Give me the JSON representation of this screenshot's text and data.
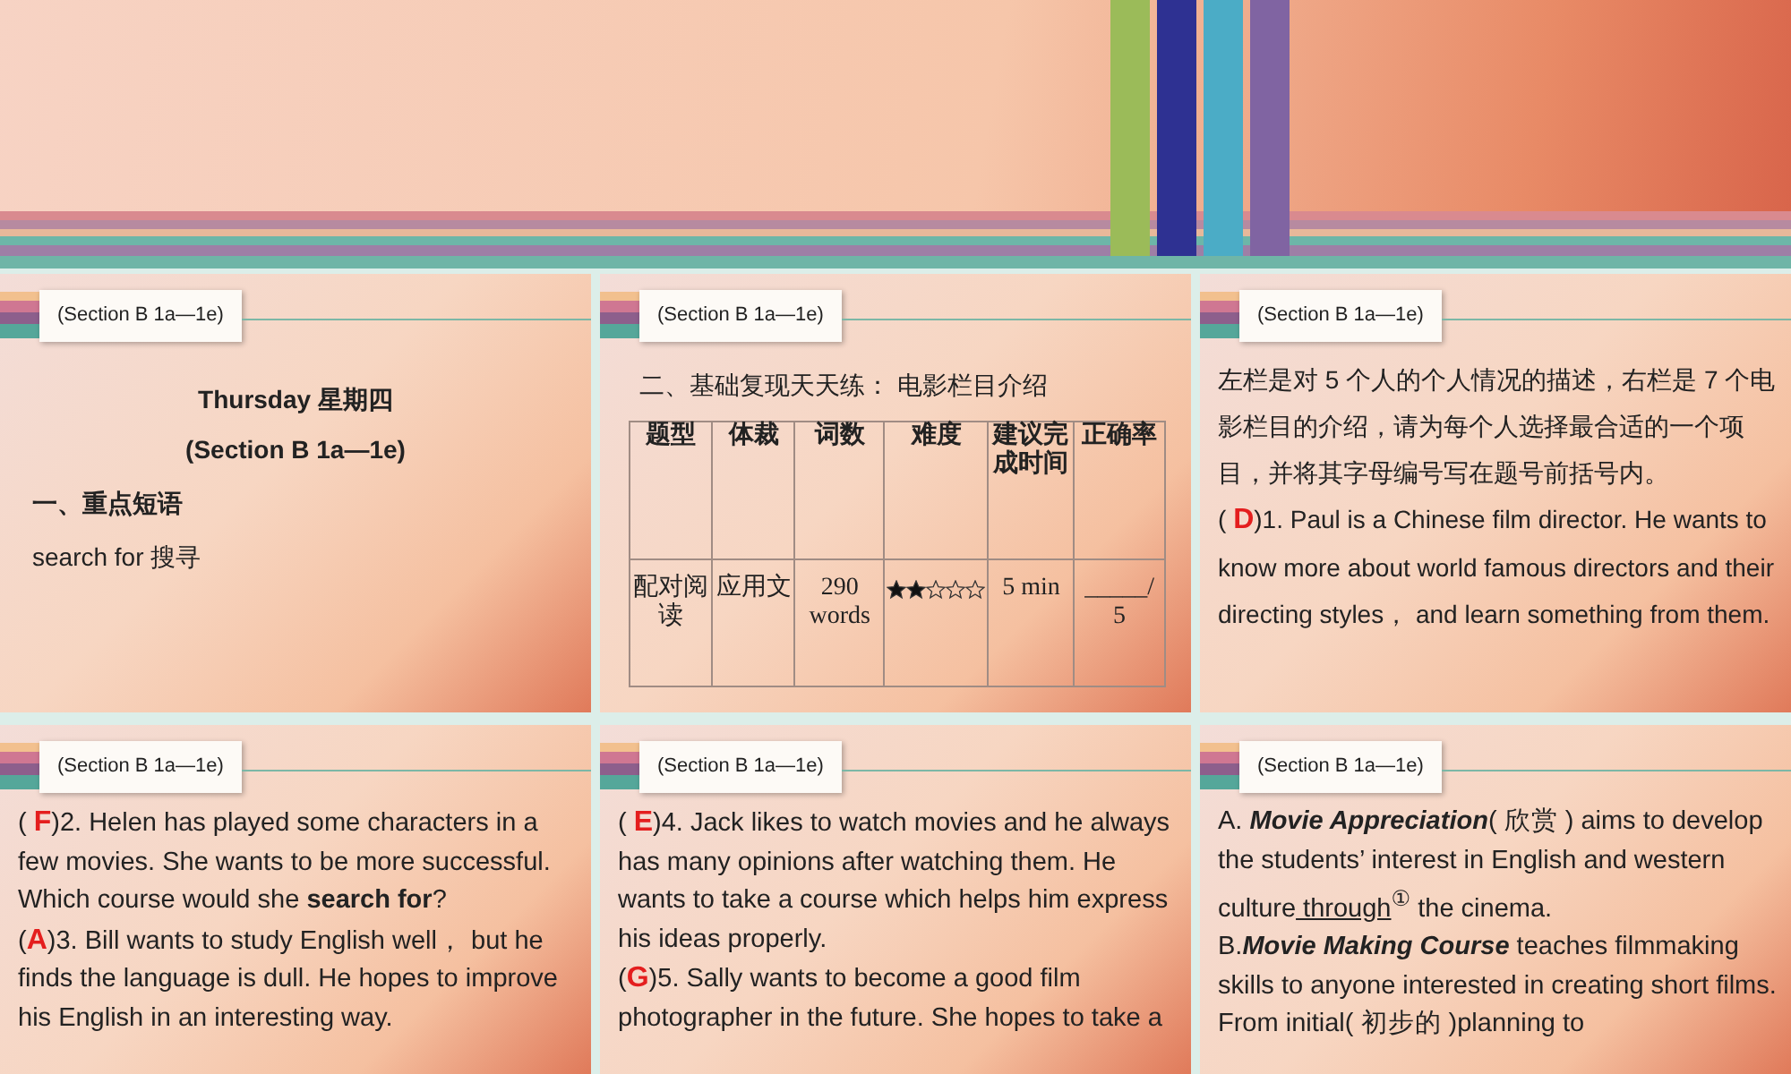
{
  "slides": [
    {
      "kind": "title",
      "header": "(Section B 1a—1e)",
      "title": "Thursday   星期四",
      "subtitle": "(Section B 1a—1e)",
      "heading": "一、重点短语",
      "lines": [
        "search for  搜寻"
      ]
    },
    {
      "kind": "table",
      "header": "(Section B 1a—1e)",
      "heading": "二、基础复现天天练：  电影栏目介绍",
      "columns": [
        "题型",
        "体裁",
        "词数",
        "难度",
        "建议完成时间",
        "正确率"
      ],
      "row": [
        {
          "kind": "text",
          "text": "配对阅读"
        },
        {
          "kind": "text",
          "text": "应用文"
        },
        {
          "kind": "text",
          "text": "290 words"
        },
        {
          "kind": "stars",
          "stars": 2
        },
        {
          "kind": "text",
          "text": "5 min"
        },
        {
          "kind": "text",
          "text": "_____/ 5"
        }
      ]
    },
    {
      "kind": "text",
      "header": "(Section B 1a—1e)",
      "paragraphs": [
        [
          {
            "kind": "plain",
            "text": "左栏是对 5 个人的个人情况的描述，右栏是 7 个电影栏目的介绍，请为每个人选择最合适的一个项目，并将其字母编号写在题号前括号内。"
          }
        ],
        [
          {
            "kind": "plain",
            "text": "( "
          },
          {
            "kind": "answer",
            "text": "D"
          },
          {
            "kind": "plain",
            "text": ")1.  Paul is a Chinese film director. He wants to know more about world famous directors and their directing styles，  and learn something from them."
          }
        ]
      ]
    },
    {
      "kind": "text",
      "header": "(Section B 1a—1e)",
      "paragraphs": [
        [
          {
            "kind": "plain",
            "text": "( "
          },
          {
            "kind": "answer",
            "text": "F"
          },
          {
            "kind": "plain",
            "text": ")2. Helen has played some characters in a few movies. She wants to be more successful. Which course would she **search for**?"
          }
        ],
        [
          {
            "kind": "plain",
            "text": "("
          },
          {
            "kind": "answer",
            "text": "A"
          },
          {
            "kind": "plain",
            "text": ")3. Bill wants to study English well，  but he finds the language is dull. He hopes to improve his English in an interesting way."
          }
        ]
      ]
    },
    {
      "kind": "text",
      "header": "(Section B 1a—1e)",
      "paragraphs": [
        [
          {
            "kind": "plain",
            "text": "( "
          },
          {
            "kind": "answer",
            "text": "E"
          },
          {
            "kind": "plain",
            "text": ")4. Jack likes to watch movies and he always has many opinions after watching them. He wants to take a course which helps him express his ideas properly."
          }
        ],
        [
          {
            "kind": "plain",
            "text": "("
          },
          {
            "kind": "answer",
            "text": "G"
          },
          {
            "kind": "plain",
            "text": ")5. Sally wants to become a good film photographer in the future. She hopes to take a"
          }
        ]
      ]
    },
    {
      "kind": "text",
      "header": "(Section B 1a—1e)",
      "paragraphs": [
        [
          {
            "kind": "plain",
            "text": "A. *Movie Appreciation*( 欣赏 ) aims to develop the students’ interest in English and western culture"
          },
          {
            "kind": "underline",
            "text": " through"
          },
          {
            "kind": "plain",
            "text": "$^{①}$ the cinema."
          }
        ],
        [
          {
            "kind": "plain",
            "text": "B.*Movie Making Course* teaches filmmaking skills to anyone interested in creating short films. From initial( 初步的 )planning to"
          }
        ]
      ]
    }
  ]
}
